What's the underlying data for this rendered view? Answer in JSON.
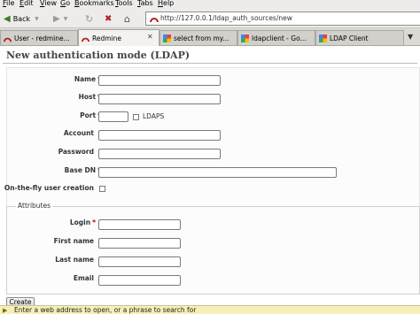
{
  "menu": {
    "items": [
      {
        "mnemonic": "F",
        "rest": "ile"
      },
      {
        "mnemonic": "E",
        "rest": "dit"
      },
      {
        "mnemonic": "V",
        "rest": "iew"
      },
      {
        "mnemonic": "G",
        "rest": "o"
      },
      {
        "mnemonic": "B",
        "rest": "ookmarks"
      },
      {
        "mnemonic": "T",
        "rest": "ools"
      },
      {
        "mnemonic": "T",
        "rest": "abs"
      },
      {
        "mnemonic": "H",
        "rest": "elp"
      }
    ]
  },
  "nav": {
    "back_label": "Back",
    "url": "http://127.0.0.1/ldap_auth_sources/new"
  },
  "tabs": [
    {
      "label": "User - redmine...",
      "icon": "redmine-icon",
      "active": false
    },
    {
      "label": "Redmine",
      "icon": "redmine-icon",
      "active": true
    },
    {
      "label": "select from my...",
      "icon": "google-icon",
      "active": false
    },
    {
      "label": "ldapclient - Go...",
      "icon": "google-icon",
      "active": false
    },
    {
      "label": "LDAP Client",
      "icon": "google-icon",
      "active": false
    }
  ],
  "page": {
    "title": "New authentication mode (LDAP)"
  },
  "form": {
    "name_label": "Name",
    "host_label": "Host",
    "port_label": "Port",
    "ldaps_label": "LDAPS",
    "account_label": "Account",
    "password_label": "Password",
    "base_dn_label": "Base DN",
    "onthefly_label": "On-the-fly user creation",
    "required_marker": "*"
  },
  "attributes": {
    "legend": "Attributes",
    "login_label": "Login",
    "firstname_label": "First name",
    "lastname_label": "Last name",
    "email_label": "Email"
  },
  "create_label": "Create",
  "status": {
    "text": "Enter a web address to open, or a phrase to search for"
  },
  "colors": {
    "required": "#bb0000",
    "title": "#444444",
    "status_bg": "#f6f0b8"
  }
}
